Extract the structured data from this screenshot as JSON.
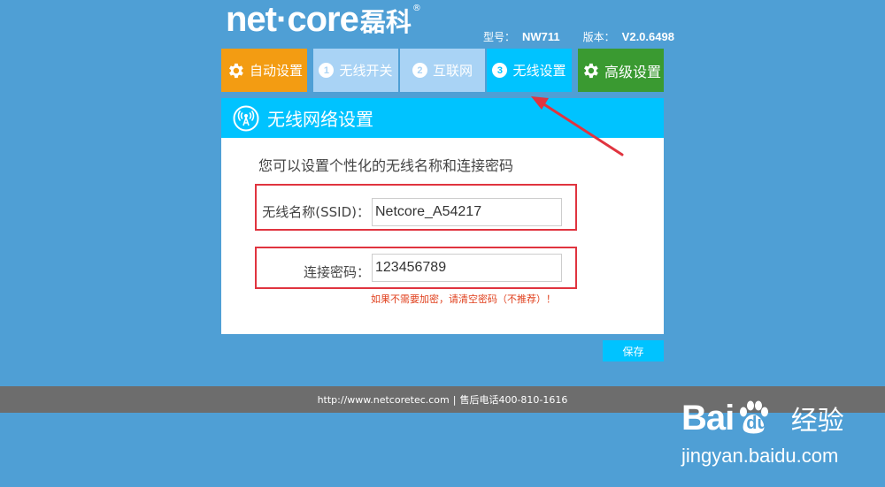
{
  "brand": {
    "name_en": "net·core",
    "name_cn": "磊科",
    "reg": "®"
  },
  "device": {
    "model_label": "型号：",
    "model": "NW711",
    "version_label": "版本：",
    "version": "V2.0.6498"
  },
  "tabs": [
    {
      "label": "自动设置",
      "icon": "gear-icon"
    },
    {
      "num": "1",
      "label": "无线开关"
    },
    {
      "num": "2",
      "label": "互联网"
    },
    {
      "num": "3",
      "label": "无线设置"
    },
    {
      "label": "高级设置",
      "icon": "gear-icon"
    }
  ],
  "panel": {
    "title": "无线网络设置",
    "intro": "您可以设置个性化的无线名称和连接密码",
    "ssid_label": "无线名称(SSID)：",
    "ssid_value": "Netcore_A54217",
    "password_label": "连接密码：",
    "password_value": "123456789",
    "hint": "如果不需要加密，请清空密码（不推荐）！",
    "save_label": "保存"
  },
  "footer": {
    "url": "http://www.netcoretec.com",
    "sep": "|",
    "hotline": "售后电话400-810-1616"
  },
  "watermark": {
    "bai": "Bai",
    "du": "du",
    "jingyan": "经验",
    "url": "jingyan.baidu.com"
  },
  "colors": {
    "background": "#4f9fd5",
    "auto_tab": "#f39c12",
    "inactive_tab": "#a9d3f5",
    "active_tab": "#00c3ff",
    "advanced_tab": "#3a9a31",
    "highlight": "#e0343f",
    "footer": "#6d6d6d"
  }
}
